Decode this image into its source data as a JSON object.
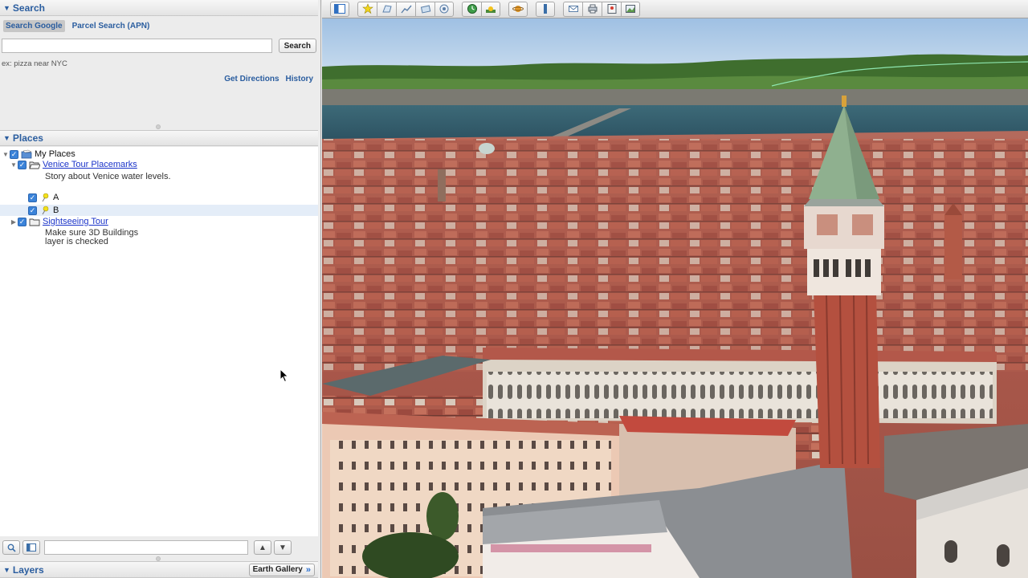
{
  "search": {
    "header": "Search",
    "tabs": [
      {
        "label": "Search Google",
        "active": true
      },
      {
        "label": "Parcel Search (APN)",
        "active": false
      }
    ],
    "input_value": "",
    "button_label": "Search",
    "hint": "ex: pizza near NYC",
    "links": {
      "directions": "Get Directions",
      "history": "History"
    }
  },
  "places": {
    "header": "Places",
    "root": {
      "label": "My Places",
      "checked": true
    },
    "folder": {
      "label": "Venice Tour Placemarks",
      "description": "Story about Venice water levels.",
      "checked": true,
      "items": [
        {
          "label": "A",
          "checked": true,
          "selected": false
        },
        {
          "label": "B",
          "checked": true,
          "selected": true
        }
      ]
    },
    "tour": {
      "label": "Sightseeing Tour",
      "description_line1": "Make sure 3D Buildings",
      "description_line2": "layer is checked",
      "checked": true
    }
  },
  "layers": {
    "header": "Layers",
    "gallery_button": "Earth Gallery",
    "gallery_chevron": "»"
  },
  "toolbar": {
    "icons": [
      "sidebar-toggle-icon",
      "placemark-icon",
      "polygon-icon",
      "path-icon",
      "image-overlay-icon",
      "record-tour-icon",
      "historical-imagery-icon",
      "sunlight-icon",
      "planets-icon",
      "ruler-icon",
      "email-icon",
      "print-icon",
      "view-in-maps-icon",
      "save-image-icon"
    ]
  },
  "colors": {
    "accent": "#2a5d9f",
    "link": "#1a33c9",
    "checkbox": "#3b83d9",
    "sky": "#a9c8e8",
    "water": "#2f5a6c",
    "roofs": "#b4544a"
  }
}
